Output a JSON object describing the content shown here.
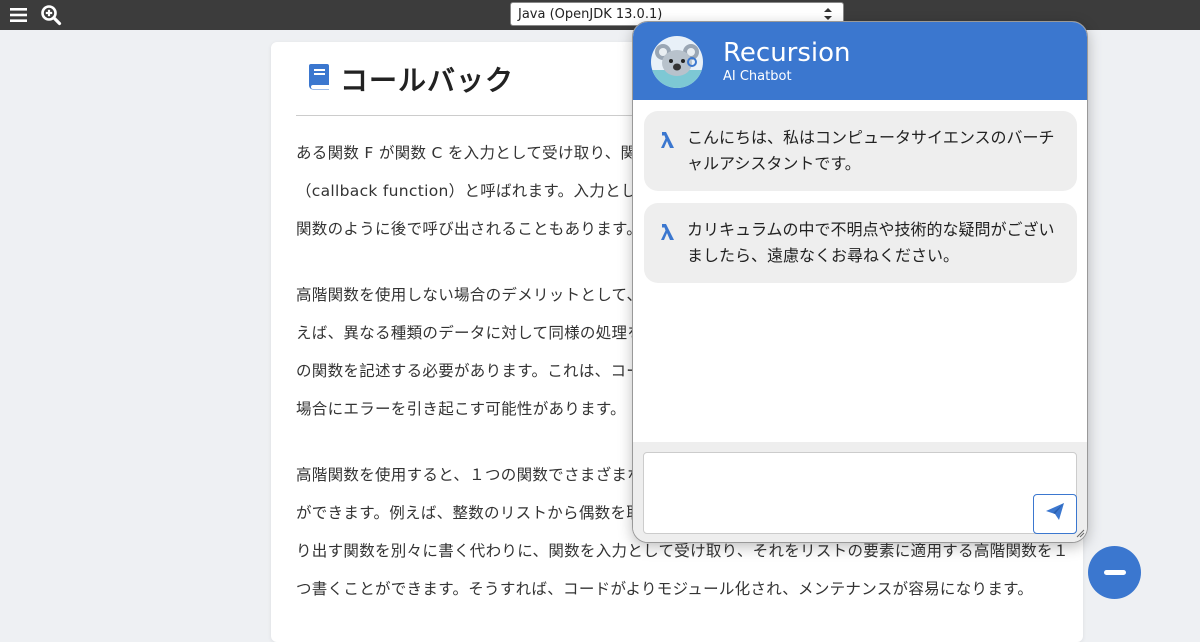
{
  "topbar": {
    "menu_icon": "hamburger-icon",
    "zoom_icon": "zoom-in-icon",
    "language_select": "Java (OpenJDK 13.0.1)"
  },
  "article": {
    "title": "コールバック",
    "title_icon": "book-icon",
    "paragraphs": [
      {
        "lines": [
          "ある関数 F が関数 C を入力として受け取り、関数",
          "（callback function）と呼ばれます。入力として",
          "関数のように後で呼び出されることもあります。"
        ]
      },
      {
        "lines": [
          "高階関数を使用しない場合のデメリットとして、",
          "えば、異なる種類のデータに対して同様の処理を",
          "の関数を記述する必要があります。これは、コー",
          "場合にエラーを引き起こす可能性があります。"
        ]
      },
      {
        "lines": [
          "高階関数を使用すると、１つの関数でさまざまな",
          "ができます。例えば、整数のリストから偶数を取",
          "り出す関数を別々に書く代わりに、関数を入力として受け取り、それをリストの要素に適用する高階関数を１",
          "つ書くことができます。そうすれば、コードがよりモジュール化され、メンテナンスが容易になります。"
        ]
      }
    ]
  },
  "chatbot": {
    "name": "Recursion",
    "subtitle": "AI Chatbot",
    "avatar_icon": "koala-avatar-icon",
    "messages": [
      {
        "text": "こんにちは、私はコンピュータサイエンスのバーチャルアシスタントです。"
      },
      {
        "text": "カリキュラムの中で不明点や技術的な疑問がございましたら、遠慮なくお尋ねください。"
      }
    ],
    "input_value": "",
    "send_icon": "paper-plane-icon"
  },
  "minimize_icon": "minus-icon",
  "colors": {
    "accent": "#3b77cf",
    "topbar": "#3c3c3c",
    "page_bg": "#eef0f3",
    "bubble_bg": "#eeeeee"
  }
}
